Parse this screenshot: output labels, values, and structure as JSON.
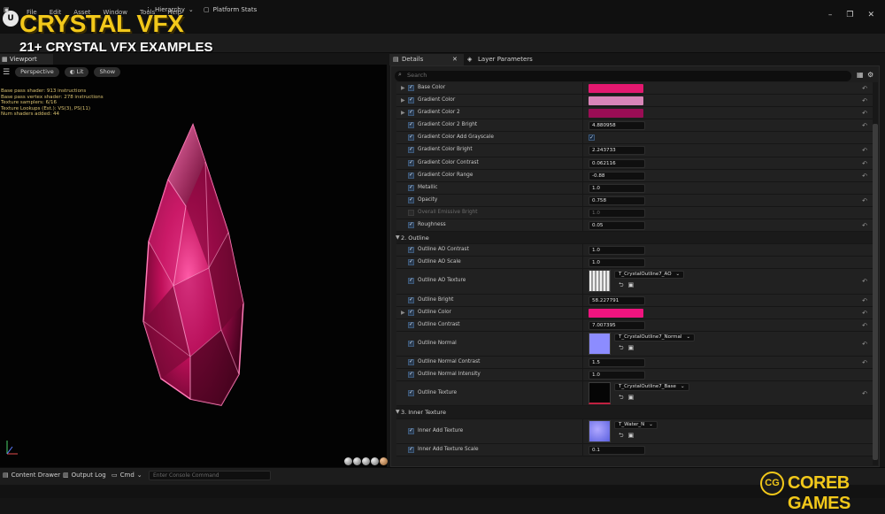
{
  "menu": [
    "File",
    "Edit",
    "Asset",
    "Window",
    "Tools",
    "Help"
  ],
  "brand": {
    "title": "CRYSTAL VFX",
    "subtitle": "21+ CRYSTAL VFX EXAMPLES",
    "bottom_badge": "CG",
    "bottom_name": "COREB GAMES"
  },
  "toolbar": {
    "hierarchy": "Hierarchy",
    "platform_stats": "Platform Stats"
  },
  "viewport": {
    "tab": "Viewport",
    "perspective": "Perspective",
    "lit": "Lit",
    "show": "Show",
    "stats": [
      "Base pass shader: 913 instructions",
      "Base pass vertex shader: 278 instructions",
      "Texture samplers: 6/16",
      "Texture Lookups (Est.): VS(3), PS(11)",
      "Num shaders added: 44"
    ]
  },
  "panel": {
    "tab_details": "Details",
    "tab_layer_params": "Layer Parameters",
    "search_placeholder": "Search",
    "rows": {
      "r0": {
        "label": "Base Color",
        "color": "#e3186f"
      },
      "r1": {
        "label": "Gradient Color",
        "color": "#d985b8"
      },
      "r2": {
        "label": "Gradient Color 2",
        "color": "#9a0d55"
      },
      "r3": {
        "label": "Gradient Color 2 Bright",
        "value": "4.880958"
      },
      "r4": {
        "label": "Gradient Color Add Grayscale"
      },
      "r5": {
        "label": "Gradient Color Bright",
        "value": "2.243733"
      },
      "r6": {
        "label": "Gradient Color Contrast",
        "value": "0.062116"
      },
      "r7": {
        "label": "Gradient Color Range",
        "value": "-0.88"
      },
      "r8": {
        "label": "Metallic",
        "value": "1.0"
      },
      "r9": {
        "label": "Opacity",
        "value": "0.758"
      },
      "r10": {
        "label": "Overall Emissive Bright",
        "value": "1.0"
      },
      "r11": {
        "label": "Roughness",
        "value": "0.05"
      },
      "c2": {
        "label": "2. Outline"
      },
      "r12": {
        "label": "Outline AO Contrast",
        "value": "1.0"
      },
      "r13": {
        "label": "Outline AO Scale",
        "value": "1.0"
      },
      "r14": {
        "label": "Outline AO Texture",
        "texture": "T_CrystalOutline7_AO"
      },
      "r15": {
        "label": "Outline Bright",
        "value": "58.227791"
      },
      "r16": {
        "label": "Outline Color",
        "color": "#f0147f"
      },
      "r17": {
        "label": "Outline Contrast",
        "value": "7.007395"
      },
      "r18": {
        "label": "Outline Normal",
        "texture": "T_CrystalOutline7_Normal"
      },
      "r19": {
        "label": "Outline Normal Contrast",
        "value": "1.5"
      },
      "r20": {
        "label": "Outline Normal Intensity",
        "value": "1.0"
      },
      "r21": {
        "label": "Outline Texture",
        "texture": "T_CrystalOutline7_Base"
      },
      "c3": {
        "label": "3. Inner Texture"
      },
      "r22": {
        "label": "Inner Add Texture",
        "texture": "T_Water_N"
      },
      "r23": {
        "label": "Inner Add Texture Scale",
        "value": "0.1"
      }
    }
  },
  "bottom": {
    "content_drawer": "Content Drawer",
    "output_log": "Output Log",
    "cmd": "Cmd",
    "console_placeholder": "Enter Console Command"
  }
}
